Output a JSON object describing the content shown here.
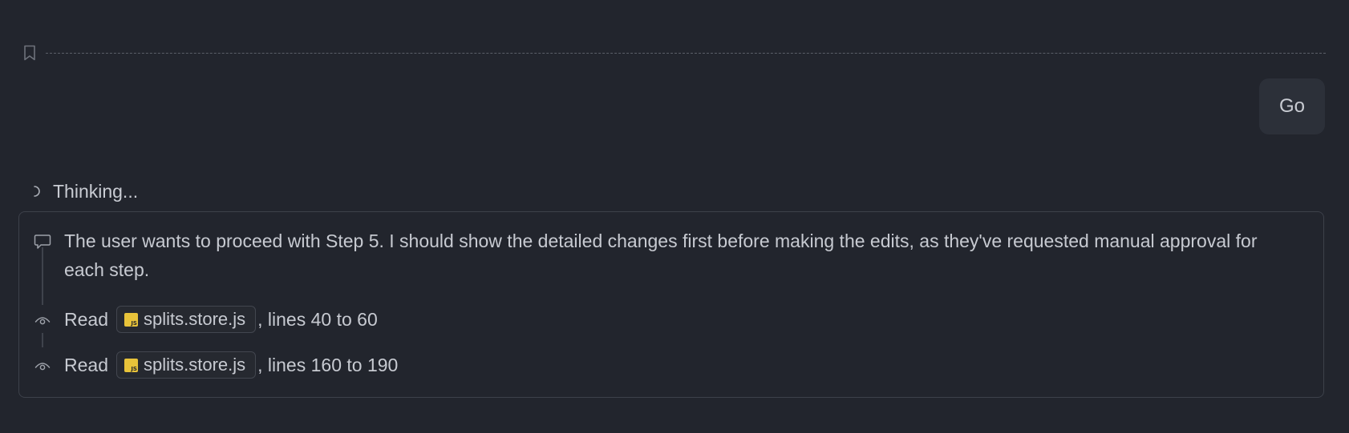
{
  "user_message": {
    "text": "Go"
  },
  "status": {
    "thinking_label": "Thinking..."
  },
  "thought_panel": {
    "thought_text": "The user wants to proceed with Step 5. I should show the detailed changes first before making the edits, as they've requested manual approval for each step.",
    "steps": [
      {
        "verb": "Read",
        "file_name": "splits.store.js",
        "file_icon": "js-file-icon",
        "range_text": ", lines 40 to 60"
      },
      {
        "verb": "Read",
        "file_name": "splits.store.js",
        "file_icon": "js-file-icon",
        "range_text": ", lines 160 to 190"
      }
    ]
  },
  "icons": {
    "bookmark": "bookmark-icon",
    "spinner": "spinner-icon",
    "thought": "speech-bubble-icon",
    "read": "eye-icon"
  },
  "colors": {
    "background": "#22252d",
    "bubble": "#2c3039",
    "panel_border": "#3d414a",
    "js_badge": "#e8c33a"
  }
}
